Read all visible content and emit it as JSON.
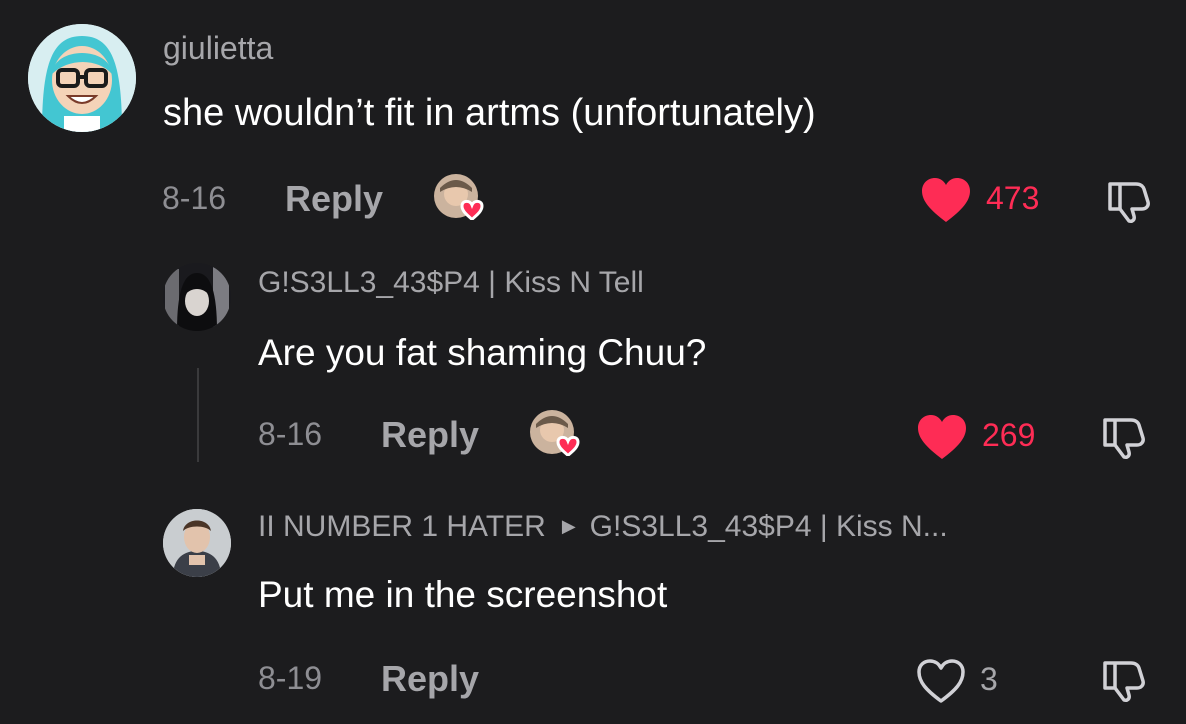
{
  "comment": {
    "username": "giulietta",
    "text": "she wouldn’t fit in artms (unfortunately)",
    "date": "8-16",
    "reply_label": "Reply",
    "likes": "473",
    "liked": true
  },
  "replies": [
    {
      "username": "G!S3LL3_43$P4 | Kiss N Tell",
      "text": "Are you fat shaming Chuu?",
      "date": "8-16",
      "reply_label": "Reply",
      "likes": "269",
      "liked": true
    },
    {
      "username": "II NUMBER 1 HATER",
      "reply_to": "G!S3LL3_43$P4 | Kiss N...",
      "text": "Put me in the screenshot",
      "date": "8-19",
      "reply_label": "Reply",
      "likes": "3",
      "liked": false
    }
  ],
  "colors": {
    "background": "#1c1c1e",
    "like_red": "#fe2c55",
    "secondary_text": "#a6a6aa"
  },
  "icons": {
    "like": "heart-icon",
    "dislike": "thumbs-down-icon",
    "creator_liked": "creator-liked-badge",
    "reply_arrow": "triangle-right-icon"
  }
}
